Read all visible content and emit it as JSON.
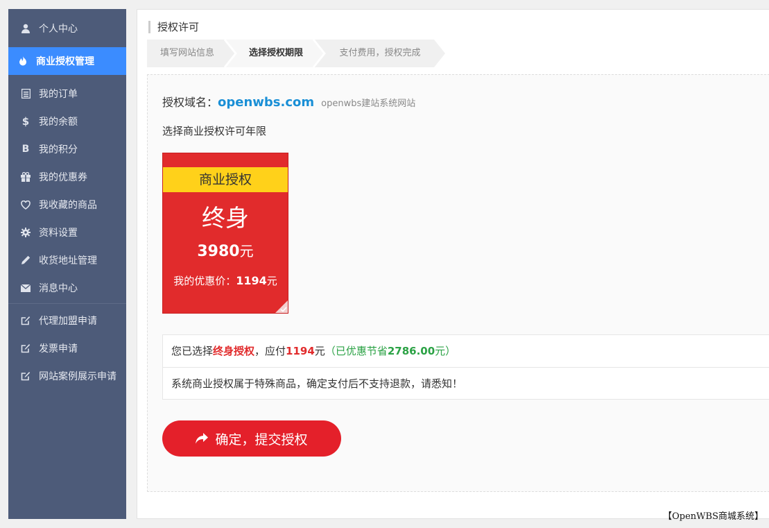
{
  "sidebar": {
    "items": [
      {
        "label": "个人中心",
        "icon": "user-icon",
        "active": false
      },
      {
        "label": "商业授权管理",
        "icon": "fire-icon",
        "active": true
      },
      {
        "label": "我的订单",
        "icon": "list-icon",
        "active": false
      },
      {
        "label": "我的余额",
        "icon": "dollar-icon",
        "active": false
      },
      {
        "label": "我的积分",
        "icon": "bitcoin-icon",
        "active": false
      },
      {
        "label": "我的优惠券",
        "icon": "gift-icon",
        "active": false
      },
      {
        "label": "我收藏的商品",
        "icon": "heart-icon",
        "active": false
      },
      {
        "label": "资料设置",
        "icon": "gear-icon",
        "active": false
      },
      {
        "label": "收货地址管理",
        "icon": "pencil-icon",
        "active": false
      },
      {
        "label": "消息中心",
        "icon": "envelope-icon",
        "active": false
      },
      {
        "label": "代理加盟申请",
        "icon": "edit-icon",
        "active": false
      },
      {
        "label": "发票申请",
        "icon": "edit-icon",
        "active": false
      },
      {
        "label": "网站案例展示申请",
        "icon": "edit-icon",
        "active": false
      }
    ]
  },
  "main": {
    "title": "授权许可",
    "steps": [
      {
        "label": "填写网站信息",
        "current": false
      },
      {
        "label": "选择授权期限",
        "current": true
      },
      {
        "label": "支付费用，授权完成",
        "current": false
      }
    ],
    "domain_label": "授权域名：",
    "domain_value": "openwbs.com",
    "domain_desc": "openwbs建站系统网站",
    "choose_label": "选择商业授权许可年限",
    "card": {
      "band": "商业授权",
      "term": "终身",
      "price": "3980",
      "price_unit": "元",
      "discount_label": "我的优惠价：",
      "discount_value": "1194",
      "discount_unit": "元",
      "selected": true
    },
    "summary": {
      "prefix": "您已选择",
      "selected_term": "终身授权",
      "pay_label": "，应付",
      "pay_value": "1194",
      "pay_unit": "元",
      "saved_prefix": "（已优惠节省",
      "saved_value": "2786.00",
      "saved_suffix": "元）",
      "notice": "系统商业授权属于特殊商品，确定支付后不支持退款，请悉知！"
    },
    "submit_label": "确定，提交授权"
  },
  "watermark": "【OpenWBS商城系统】",
  "colors": {
    "sidebar_bg": "#4d5b79",
    "active_bg": "#3b8cff",
    "card_red": "#e12b2c",
    "card_band": "#ffd11a",
    "domain_blue": "#1a8fd6",
    "saving_green": "#2ba245"
  }
}
